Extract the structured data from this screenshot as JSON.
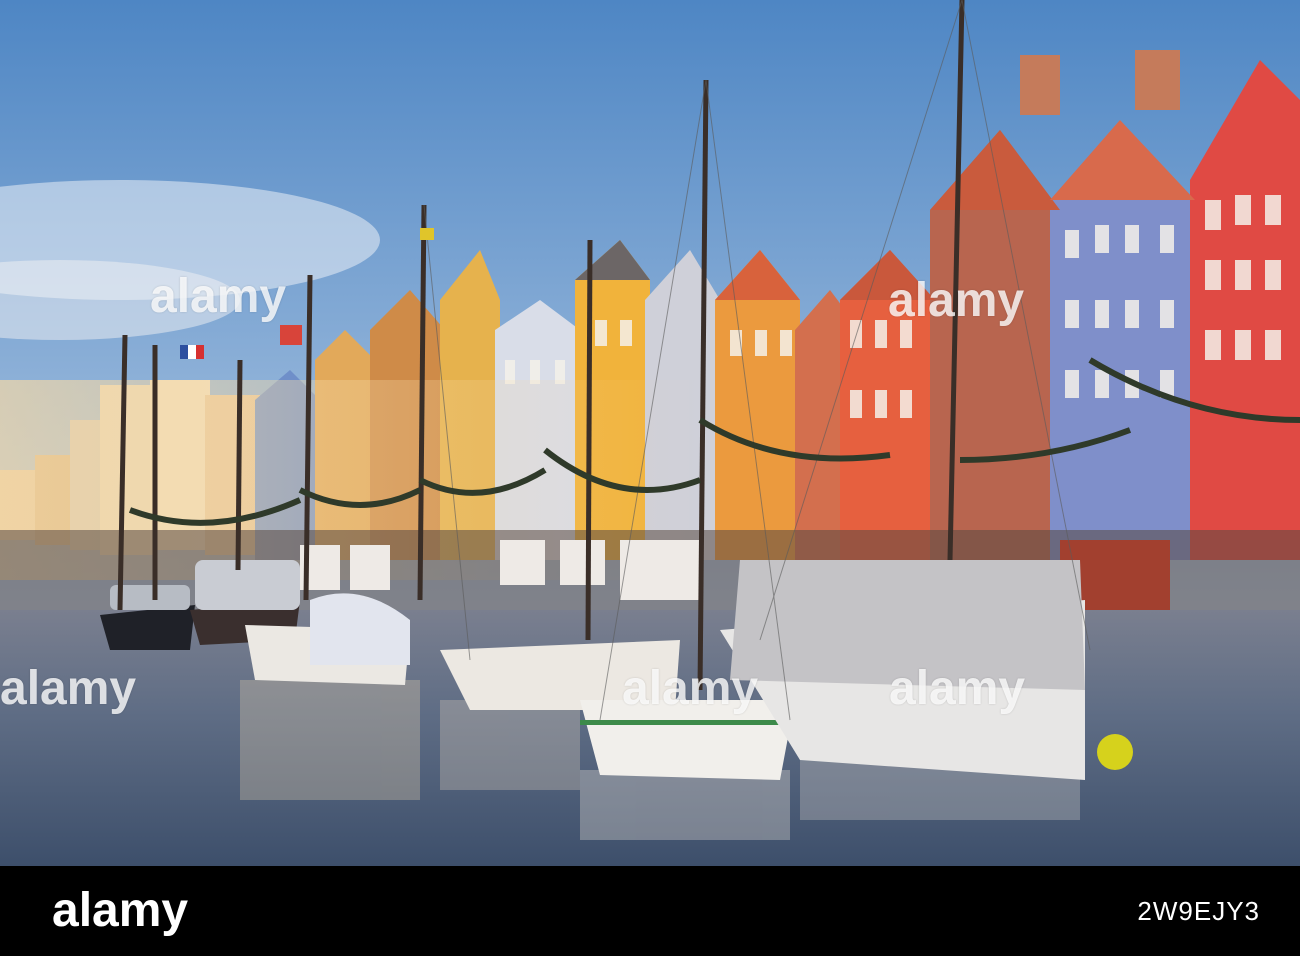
{
  "image": {
    "description_colors": {
      "sky_top": "#5b8fc7",
      "sky_bottom": "#c9d6e6",
      "water": "#5d6f86",
      "footer": "#000000"
    }
  },
  "watermark": {
    "text": "alamy"
  },
  "footer": {
    "logo": "alamy",
    "image_id": "2W9EJY3"
  }
}
